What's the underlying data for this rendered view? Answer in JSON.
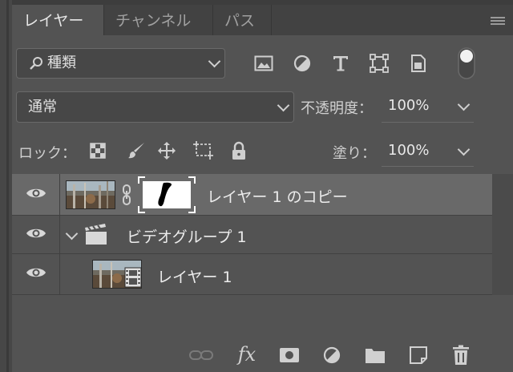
{
  "tabs": [
    "レイヤー",
    "チャンネル",
    "パス"
  ],
  "filter": {
    "icon": "search-icon",
    "kind_label": "種類"
  },
  "filter_icons": [
    "image-filter-icon",
    "adjustment-filter-icon",
    "text-filter-icon",
    "shape-filter-icon",
    "smart-object-filter-icon",
    "filter-toggle-switch"
  ],
  "blend": {
    "mode": "通常",
    "opacity_label": "不透明度：",
    "opacity_value": "100%"
  },
  "lock": {
    "label": "ロック：",
    "fill_label": "塗り：",
    "fill_value": "100%",
    "icons": [
      "lock-transparent-pixels-icon",
      "lock-image-pixels-icon",
      "lock-position-icon",
      "prevent-auto-nesting-icon",
      "lock-all-icon"
    ]
  },
  "layers": [
    {
      "name": "レイヤー 1 のコピー",
      "selected": true,
      "type": "pixel-with-mask"
    },
    {
      "name": "ビデオグループ 1",
      "selected": false,
      "type": "video-group"
    },
    {
      "name": "レイヤー 1",
      "selected": false,
      "type": "video-layer"
    }
  ],
  "bottom_icons": [
    "link-layers-icon",
    "fx-icon",
    "add-mask-icon",
    "adjustment-layer-icon",
    "group-folder-icon",
    "new-layer-icon",
    "trash-icon"
  ],
  "bottom_fx_label": "fx",
  "colors": {
    "panel": "#535353",
    "tabbar": "#424242",
    "selected_row": "#696969",
    "text": "#ececec"
  }
}
